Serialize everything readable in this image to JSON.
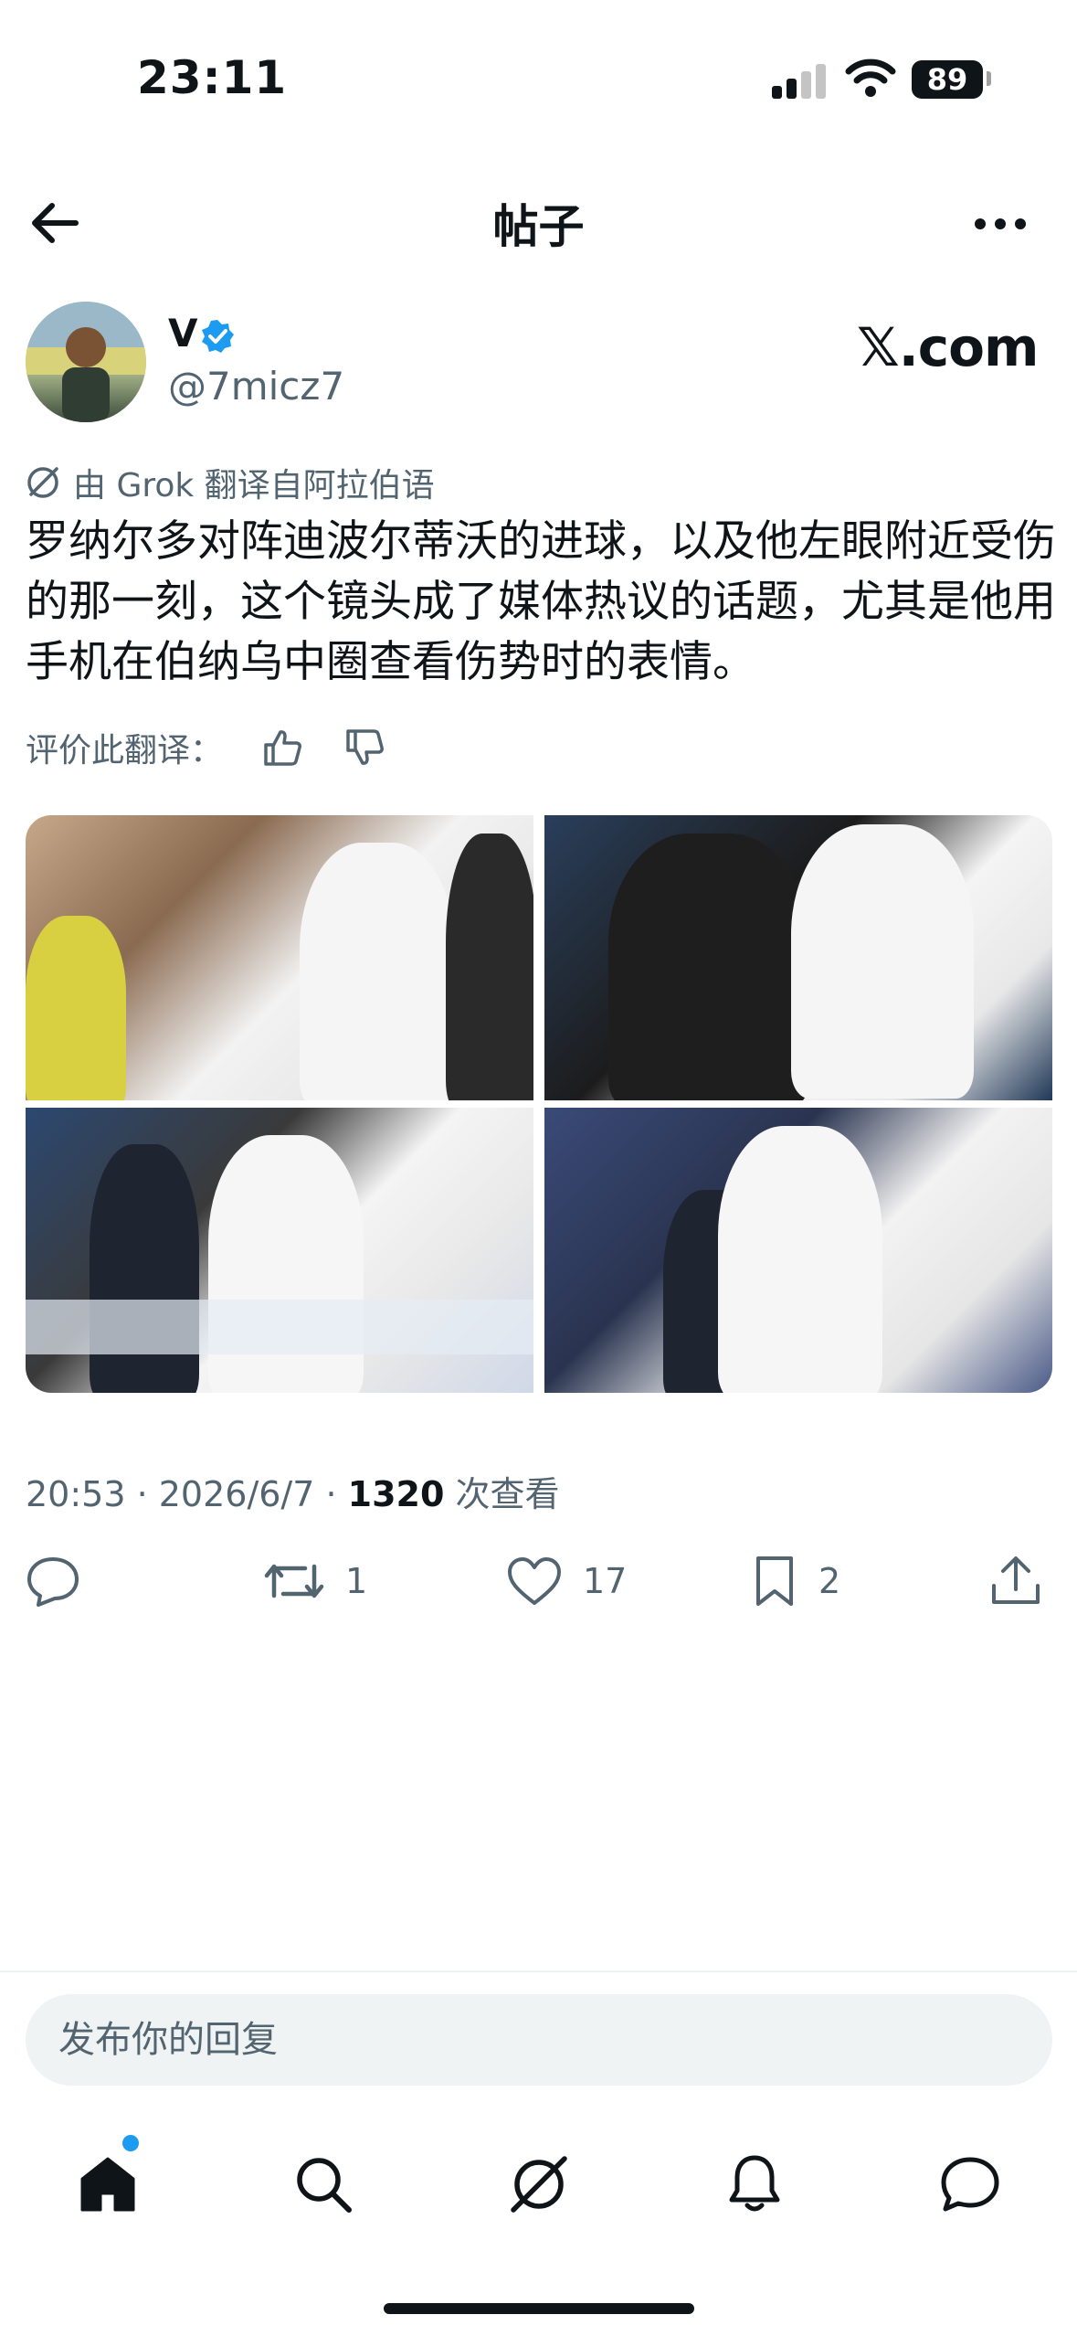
{
  "status_bar": {
    "time": "23:11",
    "battery": "89"
  },
  "header": {
    "title": "帖子"
  },
  "author": {
    "name": "V",
    "handle": "@7micz7"
  },
  "brand": {
    "logo_text": "𝕏.com"
  },
  "translation": {
    "note": "由 Grok 翻译自阿拉伯语"
  },
  "post": {
    "text": "罗纳尔多对阵迪波尔蒂沃的进球，以及他左眼附近受伤的那一刻，这个镜头成了媒体热议的话题，尤其是他用手机在伯纳乌中圈查看伤势时的表情。",
    "rate_label": "评价此翻译：",
    "time": "20:53 · 2026/6/7 · ",
    "views": "1320",
    "views_label": " 次查看"
  },
  "actions": {
    "reposts": "1",
    "likes": "17",
    "bookmarks": "2"
  },
  "reply": {
    "placeholder": "发布你的回复"
  },
  "colors": {
    "text": "#0f1419",
    "secondary": "#536471",
    "accent": "#1d9bf0",
    "input_bg": "#eff3f4"
  },
  "icons": [
    "back-arrow-icon",
    "more-icon",
    "verified-icon",
    "grok-icon",
    "thumbs-up-icon",
    "thumbs-down-icon",
    "reply-icon",
    "repost-icon",
    "like-icon",
    "bookmark-icon",
    "share-icon",
    "home-icon",
    "search-icon",
    "grok-icon",
    "notifications-icon",
    "messages-icon"
  ]
}
